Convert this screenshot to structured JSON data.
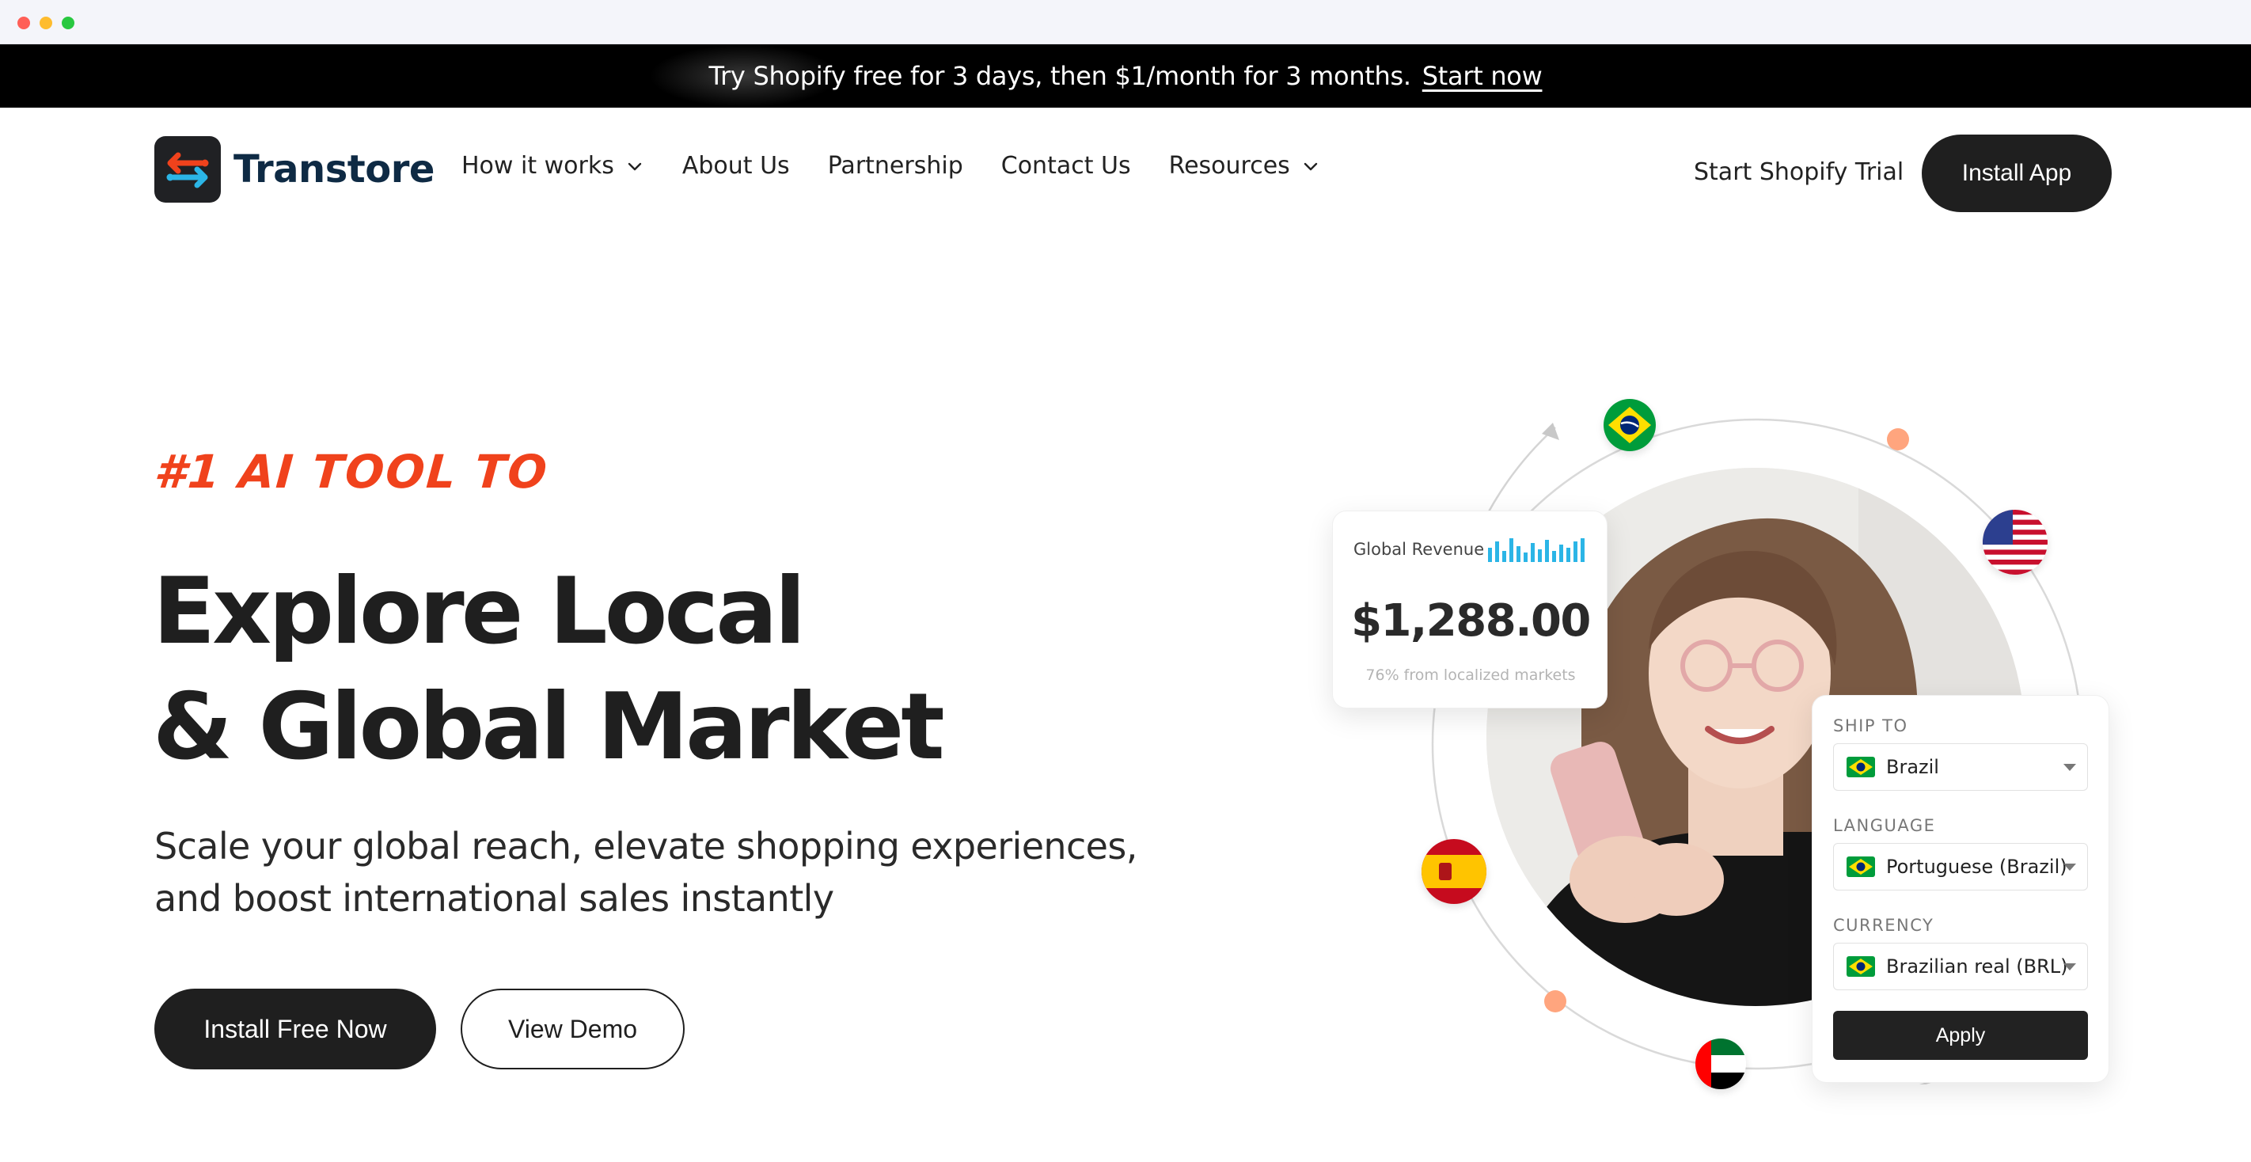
{
  "promo": {
    "text": "Try Shopify free for 3 days, then $1/month for 3 months.",
    "link": "Start now"
  },
  "nav": {
    "brand": "Transtore",
    "links": [
      {
        "label": "How it works",
        "has_dropdown": true
      },
      {
        "label": "About Us",
        "has_dropdown": false
      },
      {
        "label": "Partnership",
        "has_dropdown": false
      },
      {
        "label": "Contact Us",
        "has_dropdown": false
      },
      {
        "label": "Resources",
        "has_dropdown": true
      }
    ],
    "trial_label": "Start Shopify Trial",
    "install_label": "Install App"
  },
  "hero": {
    "eyebrow": "#1 AI TOOL TO",
    "headline_line1": "Explore Local",
    "headline_line2": "& Global Market",
    "subhead_line1": "Scale your global reach, elevate shopping experiences,",
    "subhead_line2": "and boost international sales instantly",
    "primary_cta": "Install Free Now",
    "secondary_cta": "View Demo"
  },
  "revenue_card": {
    "label": "Global Revenue",
    "amount": "$1,288.00",
    "note": "76% from localized markets"
  },
  "ship_card": {
    "ship_to_label": "SHIP TO",
    "ship_to_value": "Brazil",
    "language_label": "LANGUAGE",
    "language_value": "Portuguese (Brazil)",
    "currency_label": "CURRENCY",
    "currency_value": "Brazilian real (BRL)",
    "apply_label": "Apply"
  },
  "flags": [
    "brazil-flag-icon",
    "usa-flag-icon",
    "spain-flag-icon",
    "uae-flag-icon"
  ],
  "colors": {
    "accent": "#f0421c",
    "dark": "#1f1f1f",
    "promo_bg": "#000000",
    "chart_bars": "#2bb5e6"
  }
}
